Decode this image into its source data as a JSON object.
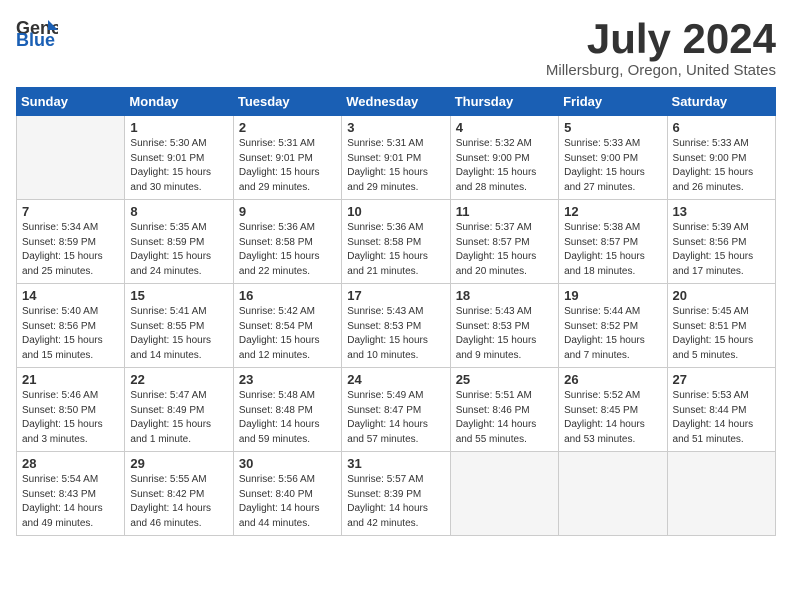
{
  "logo": {
    "general": "General",
    "blue": "Blue"
  },
  "title": "July 2024",
  "location": "Millersburg, Oregon, United States",
  "weekdays": [
    "Sunday",
    "Monday",
    "Tuesday",
    "Wednesday",
    "Thursday",
    "Friday",
    "Saturday"
  ],
  "weeks": [
    [
      {
        "day": "",
        "info": ""
      },
      {
        "day": "1",
        "info": "Sunrise: 5:30 AM\nSunset: 9:01 PM\nDaylight: 15 hours\nand 30 minutes."
      },
      {
        "day": "2",
        "info": "Sunrise: 5:31 AM\nSunset: 9:01 PM\nDaylight: 15 hours\nand 29 minutes."
      },
      {
        "day": "3",
        "info": "Sunrise: 5:31 AM\nSunset: 9:01 PM\nDaylight: 15 hours\nand 29 minutes."
      },
      {
        "day": "4",
        "info": "Sunrise: 5:32 AM\nSunset: 9:00 PM\nDaylight: 15 hours\nand 28 minutes."
      },
      {
        "day": "5",
        "info": "Sunrise: 5:33 AM\nSunset: 9:00 PM\nDaylight: 15 hours\nand 27 minutes."
      },
      {
        "day": "6",
        "info": "Sunrise: 5:33 AM\nSunset: 9:00 PM\nDaylight: 15 hours\nand 26 minutes."
      }
    ],
    [
      {
        "day": "7",
        "info": "Sunrise: 5:34 AM\nSunset: 8:59 PM\nDaylight: 15 hours\nand 25 minutes."
      },
      {
        "day": "8",
        "info": "Sunrise: 5:35 AM\nSunset: 8:59 PM\nDaylight: 15 hours\nand 24 minutes."
      },
      {
        "day": "9",
        "info": "Sunrise: 5:36 AM\nSunset: 8:58 PM\nDaylight: 15 hours\nand 22 minutes."
      },
      {
        "day": "10",
        "info": "Sunrise: 5:36 AM\nSunset: 8:58 PM\nDaylight: 15 hours\nand 21 minutes."
      },
      {
        "day": "11",
        "info": "Sunrise: 5:37 AM\nSunset: 8:57 PM\nDaylight: 15 hours\nand 20 minutes."
      },
      {
        "day": "12",
        "info": "Sunrise: 5:38 AM\nSunset: 8:57 PM\nDaylight: 15 hours\nand 18 minutes."
      },
      {
        "day": "13",
        "info": "Sunrise: 5:39 AM\nSunset: 8:56 PM\nDaylight: 15 hours\nand 17 minutes."
      }
    ],
    [
      {
        "day": "14",
        "info": "Sunrise: 5:40 AM\nSunset: 8:56 PM\nDaylight: 15 hours\nand 15 minutes."
      },
      {
        "day": "15",
        "info": "Sunrise: 5:41 AM\nSunset: 8:55 PM\nDaylight: 15 hours\nand 14 minutes."
      },
      {
        "day": "16",
        "info": "Sunrise: 5:42 AM\nSunset: 8:54 PM\nDaylight: 15 hours\nand 12 minutes."
      },
      {
        "day": "17",
        "info": "Sunrise: 5:43 AM\nSunset: 8:53 PM\nDaylight: 15 hours\nand 10 minutes."
      },
      {
        "day": "18",
        "info": "Sunrise: 5:43 AM\nSunset: 8:53 PM\nDaylight: 15 hours\nand 9 minutes."
      },
      {
        "day": "19",
        "info": "Sunrise: 5:44 AM\nSunset: 8:52 PM\nDaylight: 15 hours\nand 7 minutes."
      },
      {
        "day": "20",
        "info": "Sunrise: 5:45 AM\nSunset: 8:51 PM\nDaylight: 15 hours\nand 5 minutes."
      }
    ],
    [
      {
        "day": "21",
        "info": "Sunrise: 5:46 AM\nSunset: 8:50 PM\nDaylight: 15 hours\nand 3 minutes."
      },
      {
        "day": "22",
        "info": "Sunrise: 5:47 AM\nSunset: 8:49 PM\nDaylight: 15 hours\nand 1 minute."
      },
      {
        "day": "23",
        "info": "Sunrise: 5:48 AM\nSunset: 8:48 PM\nDaylight: 14 hours\nand 59 minutes."
      },
      {
        "day": "24",
        "info": "Sunrise: 5:49 AM\nSunset: 8:47 PM\nDaylight: 14 hours\nand 57 minutes."
      },
      {
        "day": "25",
        "info": "Sunrise: 5:51 AM\nSunset: 8:46 PM\nDaylight: 14 hours\nand 55 minutes."
      },
      {
        "day": "26",
        "info": "Sunrise: 5:52 AM\nSunset: 8:45 PM\nDaylight: 14 hours\nand 53 minutes."
      },
      {
        "day": "27",
        "info": "Sunrise: 5:53 AM\nSunset: 8:44 PM\nDaylight: 14 hours\nand 51 minutes."
      }
    ],
    [
      {
        "day": "28",
        "info": "Sunrise: 5:54 AM\nSunset: 8:43 PM\nDaylight: 14 hours\nand 49 minutes."
      },
      {
        "day": "29",
        "info": "Sunrise: 5:55 AM\nSunset: 8:42 PM\nDaylight: 14 hours\nand 46 minutes."
      },
      {
        "day": "30",
        "info": "Sunrise: 5:56 AM\nSunset: 8:40 PM\nDaylight: 14 hours\nand 44 minutes."
      },
      {
        "day": "31",
        "info": "Sunrise: 5:57 AM\nSunset: 8:39 PM\nDaylight: 14 hours\nand 42 minutes."
      },
      {
        "day": "",
        "info": ""
      },
      {
        "day": "",
        "info": ""
      },
      {
        "day": "",
        "info": ""
      }
    ]
  ]
}
